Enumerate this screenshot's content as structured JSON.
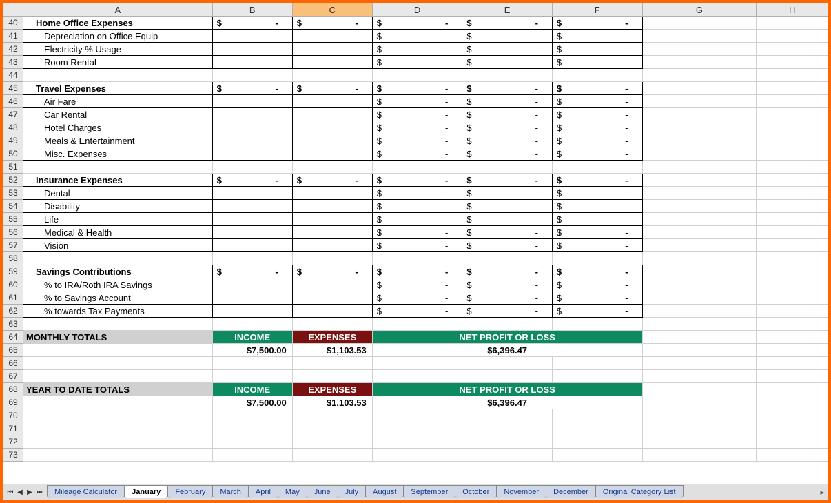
{
  "cols": [
    "A",
    "B",
    "C",
    "D",
    "E",
    "F",
    "G",
    "H"
  ],
  "rows": {
    "40": {
      "label": "Home Office Expenses",
      "bold": true,
      "indent": 1,
      "B": "$-",
      "C": "$-",
      "D": "$-",
      "E": "$-",
      "F": "$-"
    },
    "41": {
      "label": "Depreciation on Office Equip",
      "indent": 2,
      "D": "$-",
      "E": "$-",
      "F": "$-"
    },
    "42": {
      "label": "Electricity % Usage",
      "indent": 2,
      "D": "$-",
      "E": "$-",
      "F": "$-"
    },
    "43": {
      "label": "Room Rental",
      "indent": 2,
      "D": "$-",
      "E": "$-",
      "F": "$-"
    },
    "44": {
      "blank": true
    },
    "45": {
      "label": "Travel Expenses",
      "bold": true,
      "indent": 1,
      "B": "$-",
      "C": "$-",
      "D": "$-",
      "E": "$-",
      "F": "$-"
    },
    "46": {
      "label": "Air Fare",
      "indent": 2,
      "D": "$-",
      "E": "$-",
      "F": "$-"
    },
    "47": {
      "label": "Car Rental",
      "indent": 2,
      "D": "$-",
      "E": "$-",
      "F": "$-"
    },
    "48": {
      "label": "Hotel Charges",
      "indent": 2,
      "D": "$-",
      "E": "$-",
      "F": "$-"
    },
    "49": {
      "label": "Meals & Entertainment",
      "indent": 2,
      "D": "$-",
      "E": "$-",
      "F": "$-"
    },
    "50": {
      "label": "Misc. Expenses",
      "indent": 2,
      "D": "$-",
      "E": "$-",
      "F": "$-"
    },
    "51": {
      "blank": true
    },
    "52": {
      "label": "Insurance Expenses",
      "bold": true,
      "indent": 1,
      "B": "$-",
      "C": "$-",
      "D": "$-",
      "E": "$-",
      "F": "$-"
    },
    "53": {
      "label": "Dental",
      "indent": 2,
      "D": "$-",
      "E": "$-",
      "F": "$-"
    },
    "54": {
      "label": "Disability",
      "indent": 2,
      "D": "$-",
      "E": "$-",
      "F": "$-"
    },
    "55": {
      "label": "Life",
      "indent": 2,
      "D": "$-",
      "E": "$-",
      "F": "$-"
    },
    "56": {
      "label": "Medical & Health",
      "indent": 2,
      "D": "$-",
      "E": "$-",
      "F": "$-"
    },
    "57": {
      "label": "Vision",
      "indent": 2,
      "D": "$-",
      "E": "$-",
      "F": "$-"
    },
    "58": {
      "blank": true
    },
    "59": {
      "label": "Savings Contributions",
      "bold": true,
      "indent": 1,
      "B": "$-",
      "C": "$-",
      "D": "$-",
      "E": "$-",
      "F": "$-"
    },
    "60": {
      "label": "% to IRA/Roth IRA Savings",
      "indent": 2,
      "D": "$-",
      "E": "$-",
      "F": "$-"
    },
    "61": {
      "label": "% to Savings Account",
      "indent": 2,
      "D": "$-",
      "E": "$-",
      "F": "$-"
    },
    "62": {
      "label": "% towards Tax Payments",
      "indent": 2,
      "D": "$-",
      "E": "$-",
      "F": "$-"
    },
    "63": {
      "blank": true
    }
  },
  "totals": {
    "monthly": {
      "row_label": 64,
      "row_values": 65,
      "label": "MONTHLY TOTALS",
      "income_hdr": "INCOME",
      "expenses_hdr": "EXPENSES",
      "net_hdr": "NET PROFIT OR LOSS",
      "income": "$7,500.00",
      "expenses": "$1,103.53",
      "net": "$6,396.47"
    },
    "ytd": {
      "row_label": 68,
      "row_values": 69,
      "label": "YEAR TO DATE TOTALS",
      "income_hdr": "INCOME",
      "expenses_hdr": "EXPENSES",
      "net_hdr": "NET PROFIT OR LOSS",
      "income": "$7,500.00",
      "expenses": "$1,103.53",
      "net": "$6,396.47"
    }
  },
  "empty_rows": [
    66,
    67,
    70,
    71,
    72,
    73
  ],
  "tabs": [
    "Mileage Calculator",
    "January",
    "February",
    "March",
    "April",
    "May",
    "June",
    "July",
    "August",
    "September",
    "October",
    "November",
    "December",
    "Original Category List"
  ],
  "active_tab": "January"
}
